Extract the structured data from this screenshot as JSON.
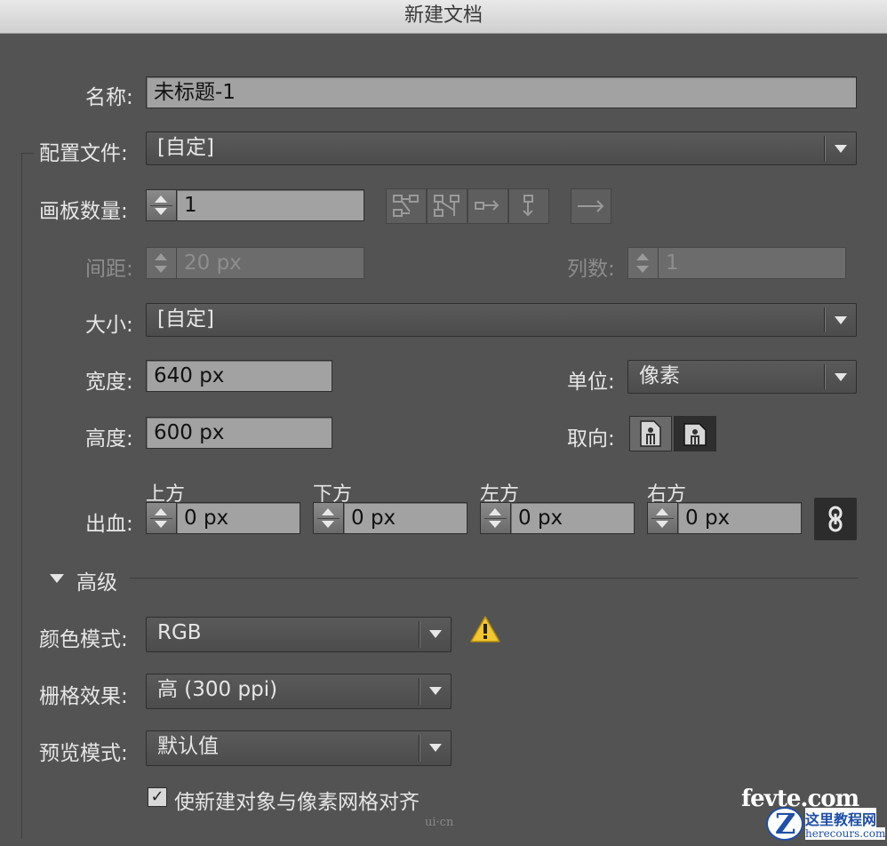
{
  "window": {
    "title": "新建文档"
  },
  "name": {
    "label": "名称:",
    "value": "未标题-1"
  },
  "profile": {
    "label": "配置文件:",
    "value": "[自定]"
  },
  "artboards": {
    "count_label": "画板数量:",
    "count_value": "1",
    "spacing_label": "间距:",
    "spacing_value": "20 px",
    "columns_label": "列数:",
    "columns_value": "1",
    "arrange_icons": [
      "grid-by-row-icon",
      "grid-by-column-icon",
      "arrange-by-row-icon",
      "arrange-by-column-icon"
    ],
    "direction_icon": "right-to-left-arrow-icon"
  },
  "size": {
    "label": "大小:",
    "value": "[自定]"
  },
  "width": {
    "label": "宽度:",
    "value": "640 px"
  },
  "height": {
    "label": "高度:",
    "value": "600 px"
  },
  "units": {
    "label": "单位:",
    "value": "像素"
  },
  "orientation": {
    "label": "取向:",
    "options": [
      "portrait-icon",
      "landscape-icon"
    ],
    "selected": "landscape-icon"
  },
  "bleed": {
    "label": "出血:",
    "top_label": "上方",
    "top_value": "0 px",
    "bottom_label": "下方",
    "bottom_value": "0 px",
    "left_label": "左方",
    "left_value": "0 px",
    "right_label": "右方",
    "right_value": "0 px",
    "link_icon": "chain-link-icon"
  },
  "advanced": {
    "label": "高级",
    "color_mode_label": "颜色模式:",
    "color_mode_value": "RGB",
    "raster_label": "栅格效果:",
    "raster_value": "高 (300 ppi)",
    "preview_label": "预览模式:",
    "preview_value": "默认值",
    "align_pixel_label": "使新建对象与像素网格对齐",
    "align_pixel_checked": true,
    "warning_icon": "warning-triangle-icon"
  },
  "watermark": {
    "site": "fevte.com",
    "cn": "这里教程网",
    "en": "herecours.com",
    "ui": "ui·cn"
  },
  "colors": {
    "panel": "#535353",
    "field": "#a2a2a2",
    "warning": "#f2c62f"
  }
}
